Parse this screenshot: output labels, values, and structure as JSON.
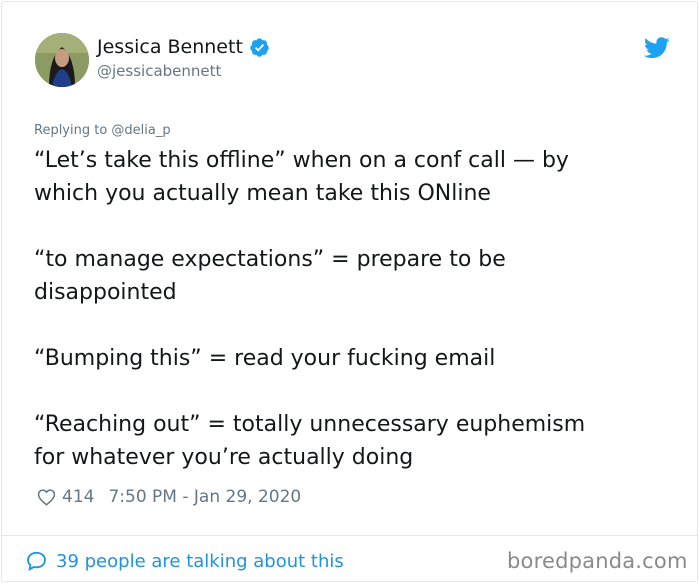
{
  "author": {
    "name": "Jessica Bennett",
    "handle": "@jessicabennett",
    "verified": true
  },
  "icons": {
    "verified": "verified-badge-icon",
    "bird": "twitter-bird-icon",
    "heart": "heart-icon",
    "bubble": "speech-bubble-icon"
  },
  "reply_to": "Replying to @delia_p",
  "tweet": {
    "lines": [
      "“Let’s take this offline” when on a conf call — by",
      "which you actually mean take this ONline",
      "",
      "“to manage expectations” = prepare to be",
      "disappointed",
      "",
      "“Bumping this” = read your fucking email",
      "",
      "“Reaching out” = totally unnecessary euphemism",
      "for whatever you’re actually doing"
    ]
  },
  "meta": {
    "likes": "414",
    "timestamp": "7:50 PM - Jan 29, 2020"
  },
  "talking": "39 people are talking about this",
  "watermark": "boredpanda.com",
  "colors": {
    "twitter_blue": "#1da1f2",
    "link_blue": "#1b95e0",
    "secondary_text": "#657786",
    "border": "#e1e8ed"
  }
}
